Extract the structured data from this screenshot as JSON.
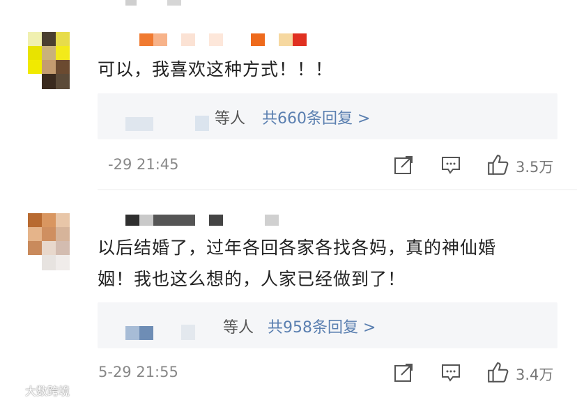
{
  "comments": [
    {
      "text": "可以，我喜欢这种方式！！！",
      "reply_prefix": "等人",
      "reply_link": "共660条回复 >",
      "time": "-29 21:45",
      "likes": "3.5万"
    },
    {
      "text_line1": "以后结婚了，过年各回各家各找各妈，真的神仙婚",
      "text_line2": "姻！我也这么想的，人家已经做到了！",
      "reply_prefix": "等人",
      "reply_link": "共958条回复 >",
      "time": "5-29 21:55",
      "likes": "3.4万"
    }
  ],
  "watermark": "大数跨境",
  "icons": [
    "share-icon",
    "comment-icon",
    "like-icon"
  ],
  "colors": {
    "link": "#5a7fb0",
    "reply_bg": "#f5f6f8",
    "meta": "#888888"
  }
}
